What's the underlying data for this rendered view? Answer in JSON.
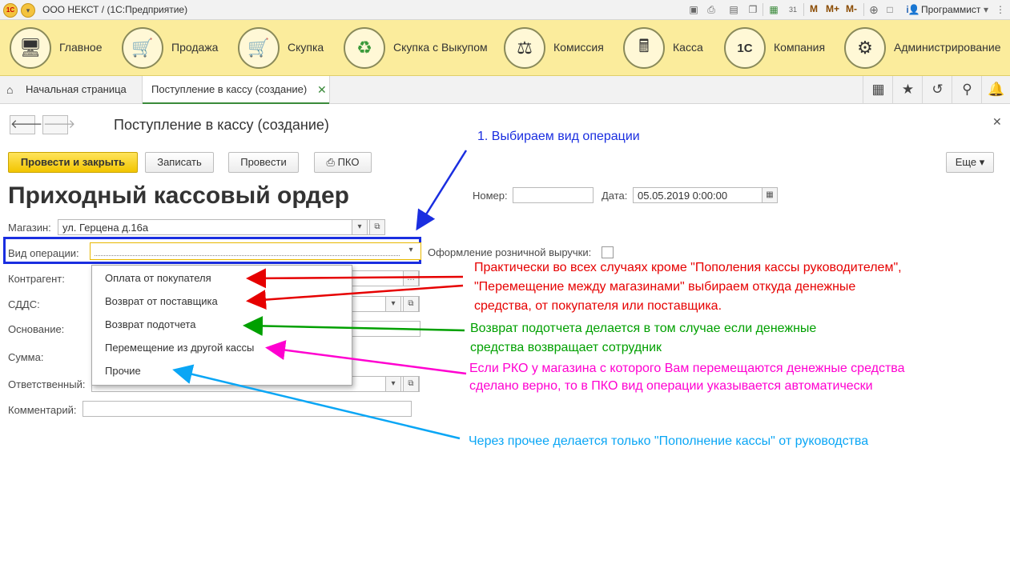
{
  "colors": {
    "blue": "#1a2ee0",
    "red": "#e60000",
    "green": "#00a000",
    "magenta": "#ff00d0",
    "cyan": "#0aa6f5"
  },
  "titlebar": {
    "app_title": "ООО НЕКСТ /  (1С:Предприятие)",
    "memory": [
      "M",
      "M+",
      "M-"
    ],
    "user": "Программист",
    "icons": [
      "save-icon",
      "print-icon",
      "document-icon",
      "copy-icon",
      "calculator-icon",
      "calendar-icon",
      "zoom-icon",
      "fullscreen-icon",
      "info-icon",
      "user-icon",
      "chevron-down-icon"
    ]
  },
  "sections": [
    {
      "label": "Главное",
      "icon": "monitor-icon",
      "glyph": "🖥"
    },
    {
      "label": "Продажа",
      "icon": "cart-up-icon",
      "glyph": "🛒"
    },
    {
      "label": "Скупка",
      "icon": "cart-down-icon",
      "glyph": "🛒"
    },
    {
      "label": "Скупка с Выкупом",
      "icon": "cycle-arrows-icon",
      "glyph": "♻"
    },
    {
      "label": "Комиссия",
      "icon": "scales-icon",
      "glyph": "⚖"
    },
    {
      "label": "Касса",
      "icon": "cash-register-icon",
      "glyph": "💳"
    },
    {
      "label": "Компания",
      "icon": "1c-logo-icon",
      "glyph": "1С"
    },
    {
      "label": "Администрирование",
      "icon": "gear-icon",
      "glyph": "⚙"
    }
  ],
  "tabs": {
    "home": "Начальная страница",
    "current": "Поступление в кассу (создание)"
  },
  "form": {
    "title": "Поступление в кассу (создание)",
    "heading": "Приходный кассовый ордер",
    "buttons": {
      "post_close": "Провести и закрыть",
      "save": "Записать",
      "post": "Провести",
      "pko": "ПКО",
      "more": "Еще"
    },
    "number_label": "Номер:",
    "number_value": "",
    "date_label": "Дата:",
    "date_value": "05.05.2019  0:00:00",
    "shop_label": "Магазин:",
    "shop_value": "ул. Герцена д.16а",
    "op_label": "Вид операции:",
    "op_value": "",
    "retail_label": "Оформление розничной выручки:",
    "counterparty_label": "Контрагент:",
    "cashflow_label": "СДДС:",
    "basis_label": "Основание:",
    "sum_label": "Сумма:",
    "responsible_label": "Ответственный:",
    "comment_label": "Комментарий:"
  },
  "dropdown": [
    "Оплата от покупателя",
    "Возврат от поставщика",
    "Возврат подотчета",
    "Перемещение из другой кассы",
    "Прочие"
  ],
  "annotations": {
    "step1": "1. Выбираем вид операции",
    "red_1": "Практически во всех случаях кроме \"Пополения кассы руководителем\",",
    "red_2": "\"Перемещение между магазинами\" выбираем откуда денежные",
    "red_3": "средства, от покупателя или поставщика.",
    "green_1": "Возврат подотчета делается в том случае если денежные",
    "green_2": "средства возвращает сотрудник",
    "magenta_1": "Если РКО у магазина с которого Вам перемещаются денежные средства",
    "magenta_2": "сделано верно, то в ПКО вид операции указывается автоматически",
    "cyan_1": "Через прочее делается только \"Пополнение кассы\" от руководства"
  }
}
